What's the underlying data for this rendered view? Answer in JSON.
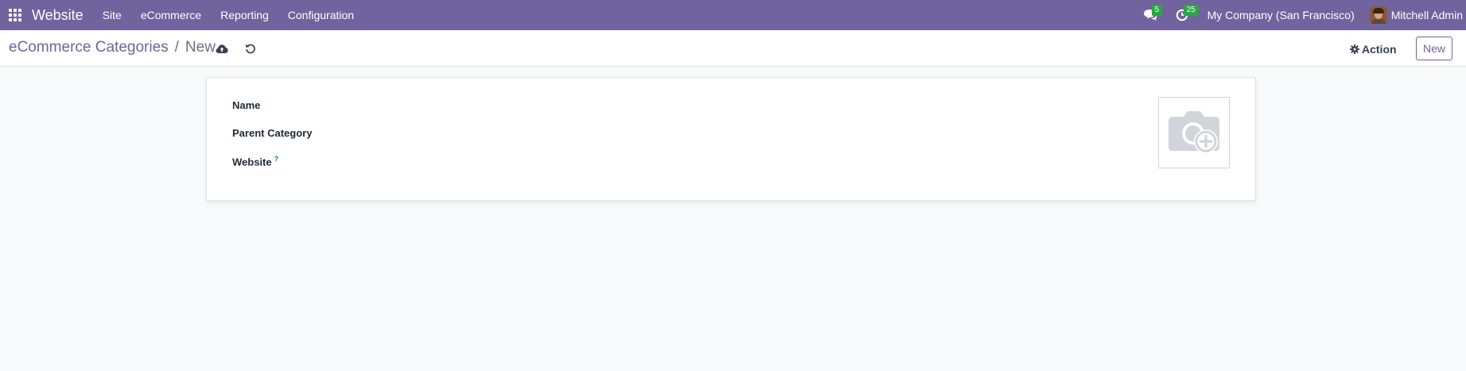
{
  "navbar": {
    "app_name": "Website",
    "menu": [
      "Site",
      "eCommerce",
      "Reporting",
      "Configuration"
    ],
    "messages_count": "5",
    "activities_count": "25",
    "company": "My Company (San Francisco)",
    "user": "Mitchell Admin"
  },
  "control_panel": {
    "breadcrumb_parent": "eCommerce Categories",
    "breadcrumb_separator": "/",
    "breadcrumb_current": "New",
    "action_label": "Action",
    "new_label": "New"
  },
  "form": {
    "fields": [
      {
        "label": "Name",
        "value": ""
      },
      {
        "label": "Parent Category",
        "value": ""
      },
      {
        "label": "Website",
        "value": "",
        "help": "?"
      }
    ]
  },
  "colors": {
    "navbar": "#71639e",
    "brand": "#71639e",
    "badge": "#28a745",
    "background": "#f9fafb"
  },
  "icons": {
    "apps": "apps-grid-icon",
    "messages": "chat-icon",
    "activities": "clock-icon",
    "save": "cloud-upload-icon",
    "discard": "undo-icon",
    "action": "gear-icon",
    "image": "camera-plus-icon"
  }
}
